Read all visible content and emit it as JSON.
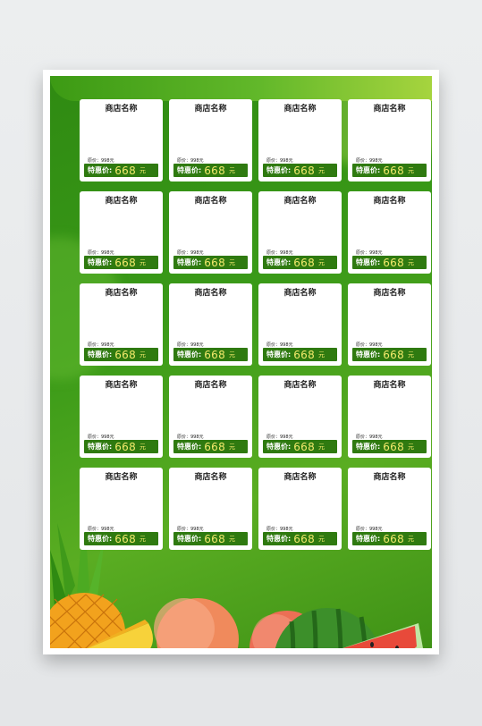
{
  "colors": {
    "bg_green": "#3a9a18",
    "price_bar": "#2f7a10",
    "price_text": "#f3e96b",
    "card": "#ffffff"
  },
  "cards": [
    {
      "shop_name": "商店名称",
      "original_price": "原价：998元",
      "special_label": "特惠价:",
      "special_price": "668",
      "unit": "元"
    },
    {
      "shop_name": "商店名称",
      "original_price": "原价：998元",
      "special_label": "特惠价:",
      "special_price": "668",
      "unit": "元"
    },
    {
      "shop_name": "商店名称",
      "original_price": "原价：998元",
      "special_label": "特惠价:",
      "special_price": "668",
      "unit": "元"
    },
    {
      "shop_name": "商店名称",
      "original_price": "原价：998元",
      "special_label": "特惠价:",
      "special_price": "668",
      "unit": "元"
    },
    {
      "shop_name": "商店名称",
      "original_price": "原价：998元",
      "special_label": "特惠价:",
      "special_price": "668",
      "unit": "元"
    },
    {
      "shop_name": "商店名称",
      "original_price": "原价：998元",
      "special_label": "特惠价:",
      "special_price": "668",
      "unit": "元"
    },
    {
      "shop_name": "商店名称",
      "original_price": "原价：998元",
      "special_label": "特惠价:",
      "special_price": "668",
      "unit": "元"
    },
    {
      "shop_name": "商店名称",
      "original_price": "原价：998元",
      "special_label": "特惠价:",
      "special_price": "668",
      "unit": "元"
    },
    {
      "shop_name": "商店名称",
      "original_price": "原价：998元",
      "special_label": "特惠价:",
      "special_price": "668",
      "unit": "元"
    },
    {
      "shop_name": "商店名称",
      "original_price": "原价：998元",
      "special_label": "特惠价:",
      "special_price": "668",
      "unit": "元"
    },
    {
      "shop_name": "商店名称",
      "original_price": "原价：998元",
      "special_label": "特惠价:",
      "special_price": "668",
      "unit": "元"
    },
    {
      "shop_name": "商店名称",
      "original_price": "原价：998元",
      "special_label": "特惠价:",
      "special_price": "668",
      "unit": "元"
    },
    {
      "shop_name": "商店名称",
      "original_price": "原价：998元",
      "special_label": "特惠价:",
      "special_price": "668",
      "unit": "元"
    },
    {
      "shop_name": "商店名称",
      "original_price": "原价：998元",
      "special_label": "特惠价:",
      "special_price": "668",
      "unit": "元"
    },
    {
      "shop_name": "商店名称",
      "original_price": "原价：998元",
      "special_label": "特惠价:",
      "special_price": "668",
      "unit": "元"
    },
    {
      "shop_name": "商店名称",
      "original_price": "原价：998元",
      "special_label": "特惠价:",
      "special_price": "668",
      "unit": "元"
    },
    {
      "shop_name": "商店名称",
      "original_price": "原价：998元",
      "special_label": "特惠价:",
      "special_price": "668",
      "unit": "元"
    },
    {
      "shop_name": "商店名称",
      "original_price": "原价：998元",
      "special_label": "特惠价:",
      "special_price": "668",
      "unit": "元"
    },
    {
      "shop_name": "商店名称",
      "original_price": "原价：998元",
      "special_label": "特惠价:",
      "special_price": "668",
      "unit": "元"
    },
    {
      "shop_name": "商店名称",
      "original_price": "原价：998元",
      "special_label": "特惠价:",
      "special_price": "668",
      "unit": "元"
    }
  ]
}
